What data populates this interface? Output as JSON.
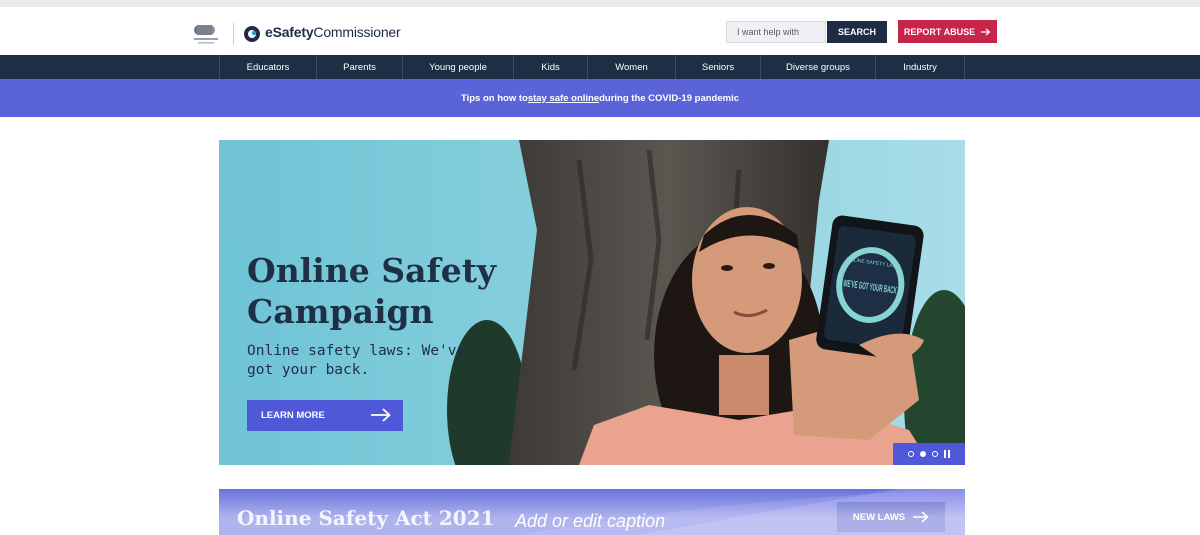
{
  "header": {
    "logo_brand": "eSafety",
    "logo_rest": "Commissioner",
    "search_placeholder": "I want help with",
    "search_button": "SEARCH",
    "report_button": "REPORT ABUSE"
  },
  "nav": {
    "items": [
      "Educators",
      "Parents",
      "Young people",
      "Kids",
      "Women",
      "Seniors",
      "Diverse groups",
      "Industry"
    ]
  },
  "banner": {
    "prefix": "Tips on how to ",
    "link": "stay safe online",
    "suffix": " during the COVID-19 pandemic"
  },
  "hero": {
    "title_line1": "Online Safety",
    "title_line2": "Campaign",
    "subtitle_line1": "Online safety laws: We've",
    "subtitle_line2": "got your back.",
    "cta": "LEARN MORE",
    "phone_text_top": "ONLINE SAFETY LAWS",
    "phone_text_main": "WE'VE GOT YOUR BACK",
    "carousel": {
      "slides": 3,
      "active_index": 1
    }
  },
  "act": {
    "title": "Online Safety Act 2021",
    "button": "NEW LAWS"
  },
  "caption": "Add or edit caption",
  "colors": {
    "navy": "#1e2e44",
    "report_red": "#c8254a",
    "accent_purple": "#4f58d6",
    "banner_purple": "#5b63d8"
  }
}
